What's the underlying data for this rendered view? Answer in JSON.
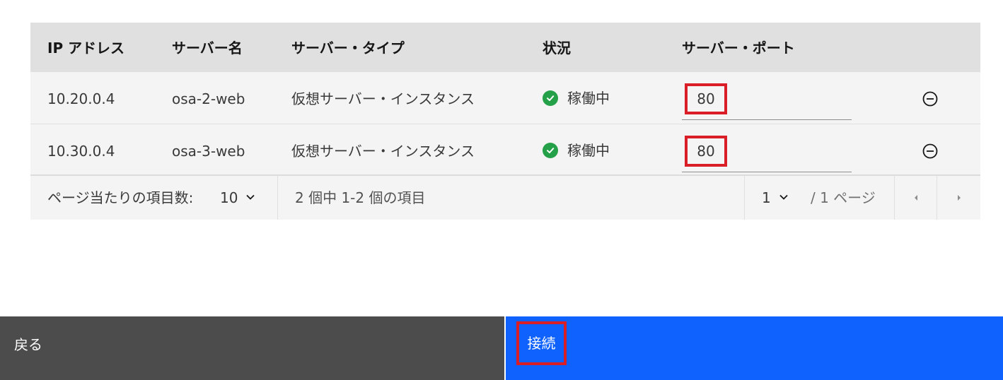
{
  "table": {
    "headers": [
      "IP アドレス",
      "サーバー名",
      "サーバー・タイプ",
      "状況",
      "サーバー・ポート"
    ],
    "rows": [
      {
        "ip": "10.20.0.4",
        "name": "osa-2-web",
        "type": "仮想サーバー・インスタンス",
        "status": "稼働中",
        "port": "80"
      },
      {
        "ip": "10.30.0.4",
        "name": "osa-3-web",
        "type": "仮想サーバー・インスタンス",
        "status": "稼働中",
        "port": "80"
      }
    ]
  },
  "pagination": {
    "items_per_page_label": "ページ当たりの項目数:",
    "items_per_page_value": "10",
    "range_text": "2 個中 1-2 個の項目",
    "page_value": "1",
    "total_pages_text": "/ 1 ページ"
  },
  "footer": {
    "back_label": "戻る",
    "connect_label": "接続"
  },
  "colors": {
    "primary": "#0f62fe",
    "secondary": "#4c4c4c",
    "success": "#24a148",
    "highlight": "#da1e28"
  },
  "icons": {
    "status": "checkmark-filled-icon",
    "remove": "subtract-circle-icon",
    "dropdown": "chevron-down-icon",
    "prev": "caret-left-icon",
    "next": "caret-right-icon"
  }
}
